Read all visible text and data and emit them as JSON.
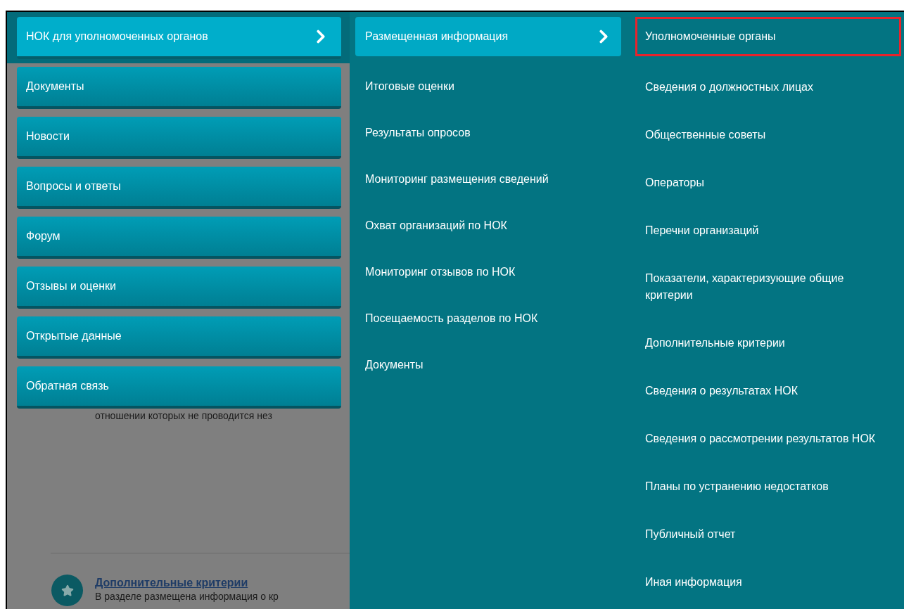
{
  "main_menu": [
    {
      "label": "НОК для уполномоченных органов",
      "selected": true
    },
    {
      "label": "Документы",
      "selected": false
    },
    {
      "label": "Новости",
      "selected": false
    },
    {
      "label": "Вопросы и ответы",
      "selected": false
    },
    {
      "label": "Форум",
      "selected": false
    },
    {
      "label": "Отзывы и оценки",
      "selected": false
    },
    {
      "label": "Открытые данные",
      "selected": false
    },
    {
      "label": "Обратная связь",
      "selected": false
    }
  ],
  "submenu": [
    {
      "label": "Размещенная информация",
      "selected": true
    },
    {
      "label": "Итоговые оценки",
      "selected": false
    },
    {
      "label": "Результаты опросов",
      "selected": false
    },
    {
      "label": "Мониторинг размещения сведений",
      "selected": false
    },
    {
      "label": "Охват организаций по НОК",
      "selected": false
    },
    {
      "label": "Мониторинг отзывов по НОК",
      "selected": false
    },
    {
      "label": "Посещаемость разделов по НОК",
      "selected": false
    },
    {
      "label": "Документы",
      "selected": false
    }
  ],
  "section_links": [
    {
      "label": "Уполномоченные органы",
      "highlighted": true
    },
    {
      "label": "Сведения о должностных лицах",
      "highlighted": false
    },
    {
      "label": "Общественные советы",
      "highlighted": false
    },
    {
      "label": "Операторы",
      "highlighted": false
    },
    {
      "label": "Перечни организаций",
      "highlighted": false
    },
    {
      "label": "Показатели, характеризующие общие критерии",
      "highlighted": false
    },
    {
      "label": "Дополнительные критерии",
      "highlighted": false
    },
    {
      "label": "Сведения о результатах НОК",
      "highlighted": false
    },
    {
      "label": "Сведения о рассмотрении результатов НОК",
      "highlighted": false
    },
    {
      "label": "Планы по устранению недостатков",
      "highlighted": false
    },
    {
      "label": "Публичный отчет",
      "highlighted": false
    },
    {
      "label": "Иная информация",
      "highlighted": false
    }
  ],
  "background_page": {
    "text_fragment": "отношении которых не проводится нез",
    "link": "Дополнительные критерии",
    "description": "В разделе размещена информация о кр"
  }
}
